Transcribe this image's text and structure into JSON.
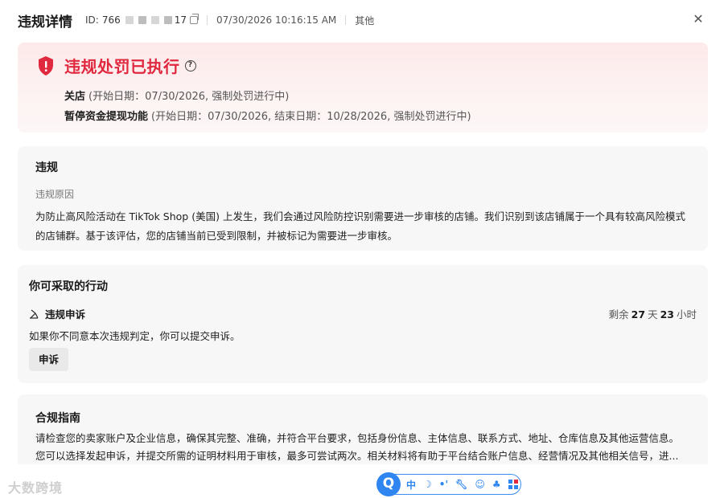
{
  "header": {
    "title": "违规详情",
    "id_label": "ID:",
    "id_prefix": "766",
    "id_suffix": "17",
    "timestamp": "07/30/2026 10:16:15 AM",
    "category": "其他",
    "close_glyph": "✕"
  },
  "banner": {
    "title": "违规处罚已执行",
    "help_glyph": "?",
    "penalties": [
      {
        "name": "关店",
        "detail": "(开始日期：07/30/2026, 强制处罚进行中)"
      },
      {
        "name": "暂停资金提现功能",
        "detail": "(开始日期：07/30/2026, 结束日期：10/28/2026, 强制处罚进行中)"
      }
    ],
    "accent_color": "#e0283f"
  },
  "violation": {
    "heading": "违规",
    "reason_label": "违规原因",
    "reason_text": "为防止高风险活动在 TikTok Shop (美国) 上发生，我们会通过风险防控识别需要进一步审核的店铺。我们识别到该店铺属于一个具有较高风险模式的店铺群。基于该评估，您的店铺当前已受到限制，并被标记为需要进一步审核。"
  },
  "actions": {
    "heading": "你可采取的行动",
    "appeal_title": "违规申诉",
    "remain_prefix": "剩余",
    "remain_days": "27",
    "remain_days_unit": "天",
    "remain_hours": "23",
    "remain_hours_unit": "小时",
    "description": "如果你不同意本次违规判定，你可以提交申诉。",
    "appeal_button": "申诉"
  },
  "compliance": {
    "heading": "合规指南",
    "line1": "请检查您的卖家账户及企业信息，确保其完整、准确，并符合平台要求，包括身份信息、主体信息、联系方式、地址、仓库信息及其他运营信息。",
    "line2": "您可以选择发起申诉，并提交所需的证明材料用于审核，最多可尝试两次。相关材料将有助于平台结合账户信息、经营情况及其他相关信号，进..."
  },
  "bottom": {
    "watermark": "大数跨境",
    "ime_logo": "Q",
    "ime_lang": "中"
  },
  "icons": {
    "shield": "shield-alert-icon",
    "copy": "copy-icon",
    "appeal": "appeal-icon"
  }
}
